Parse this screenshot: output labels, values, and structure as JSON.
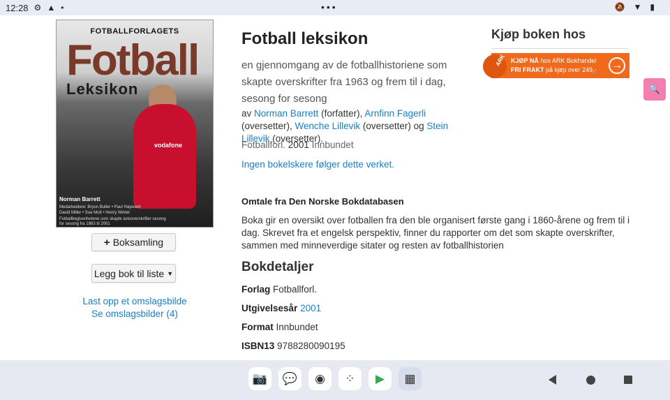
{
  "status": {
    "time": "12:28",
    "dots": "•••"
  },
  "cover": {
    "publisher": "FOTBALLFORLAGETS",
    "title": "Fotball",
    "subtitle": "Leksikon",
    "sponsor": "vodafone",
    "author": "Norman Barrett",
    "contributors": "Medarbeidere: Bryon Butler • Paul Hayward David Miller • Sue Mott • Henry Winter",
    "tagline": "Fotballbegivenhetene som skapte avisoverskrifter sesong for sesong fra 1863 til 2001"
  },
  "actions": {
    "collection_label": "Boksamling",
    "add_list_label": "Legg bok til liste",
    "upload_cover": "Last opp et omslagsbilde",
    "see_covers": "Se omslagsbilder (4)"
  },
  "book": {
    "title": "Fotball leksikon",
    "subtitle": "en gjennomgang av de fotballhistoriene som skapte overskrifter fra 1963 og frem til i dag, sesong for sesong",
    "by": "av",
    "author1": "Norman Barrett",
    "role1": "(forfatter),",
    "author2": "Arnfinn Fagerli",
    "role2": "(oversetter),",
    "author3": "Wenche Lillevik",
    "role3": "(oversetter) og",
    "author4": "Stein Lillevik",
    "role4": "(oversetter).",
    "publisher_short": "Fotballforl.",
    "year": "2001",
    "binding": "Innbundet",
    "no_followers": "Ingen bokelskere følger dette verket."
  },
  "description": {
    "heading": "Omtale fra Den Norske Bokdatabasen",
    "text": "Boka gir en oversikt over fotballen fra den ble organisert første gang i 1860-årene og frem til i dag. Skrevet fra et engelsk perspektiv, finner du rapporter om det som skapte overskrifter, sammen med minneverdige sitater og resten av fotballhistorien"
  },
  "details": {
    "heading": "Bokdetaljer",
    "forlag_label": "Forlag",
    "forlag_value": "Fotballforl.",
    "year_label": "Utgivelsesår",
    "year_value": "2001",
    "format_label": "Format",
    "format_value": "Innbundet",
    "isbn_label": "ISBN13",
    "isbn_value": "9788280090195"
  },
  "buy": {
    "heading": "Kjøp boken hos",
    "brand": "ARK",
    "line1_bold": "KJØP NÅ",
    "line1_rest": "hos ARK Bokhandel",
    "line2_bold": "FRI FRAKT",
    "line2_rest": "på kjøp over 249,-"
  },
  "colors": {
    "link": "#1a7fc1",
    "banner": "#f06a1d",
    "zoom": "#f27fb0"
  }
}
